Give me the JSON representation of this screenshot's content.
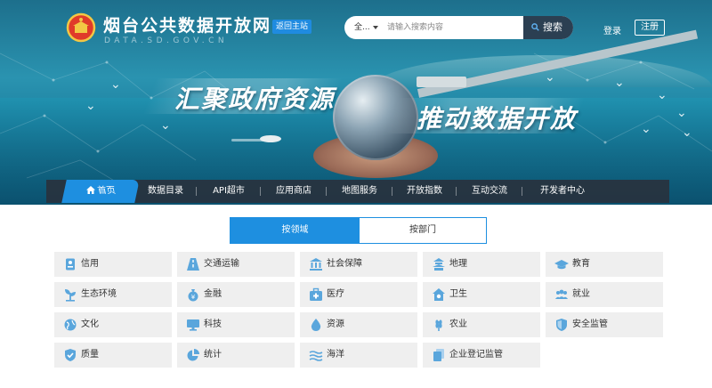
{
  "header": {
    "title": "烟台公共数据开放网",
    "subtitle": "DATA.SD.GOV.CN",
    "return_home": "返回主站",
    "search": {
      "scope": "全...",
      "placeholder": "请输入搜索内容",
      "button": "搜索"
    },
    "login": "登录",
    "register": "注册"
  },
  "banner": {
    "slogan_left": "汇聚政府资源",
    "slogan_right": "推动数据开放"
  },
  "nav": {
    "items": [
      {
        "label": "首页"
      },
      {
        "label": "数据目录"
      },
      {
        "label": "API超市"
      },
      {
        "label": "应用商店"
      },
      {
        "label": "地图服务"
      },
      {
        "label": "开放指数"
      },
      {
        "label": "互动交流"
      },
      {
        "label": "开发者中心"
      }
    ]
  },
  "tabs": {
    "by_domain": "按领域",
    "by_department": "按部门"
  },
  "categories": [
    {
      "label": "信用",
      "icon": "id-card-icon"
    },
    {
      "label": "交通运输",
      "icon": "road-icon"
    },
    {
      "label": "社会保障",
      "icon": "bank-icon"
    },
    {
      "label": "地理",
      "icon": "pagoda-icon"
    },
    {
      "label": "教育",
      "icon": "graduation-cap-icon"
    },
    {
      "label": "生态环境",
      "icon": "plant-icon"
    },
    {
      "label": "金融",
      "icon": "money-bag-icon"
    },
    {
      "label": "医疗",
      "icon": "medical-kit-icon"
    },
    {
      "label": "卫生",
      "icon": "house-icon"
    },
    {
      "label": "就业",
      "icon": "users-icon"
    },
    {
      "label": "文化",
      "icon": "globe-icon"
    },
    {
      "label": "科技",
      "icon": "monitor-icon"
    },
    {
      "label": "资源",
      "icon": "water-drop-icon"
    },
    {
      "label": "农业",
      "icon": "wheat-icon"
    },
    {
      "label": "安全监管",
      "icon": "shield-icon"
    },
    {
      "label": "质量",
      "icon": "badge-shield-icon"
    },
    {
      "label": "统计",
      "icon": "pie-chart-icon"
    },
    {
      "label": "海洋",
      "icon": "waves-icon"
    },
    {
      "label": "企业登记监管",
      "icon": "documents-icon"
    }
  ],
  "colors": {
    "accent": "#1e8fe0",
    "nav_bg": "#28323e",
    "tile_bg": "#efefef",
    "icon": "#5aa6dc"
  }
}
